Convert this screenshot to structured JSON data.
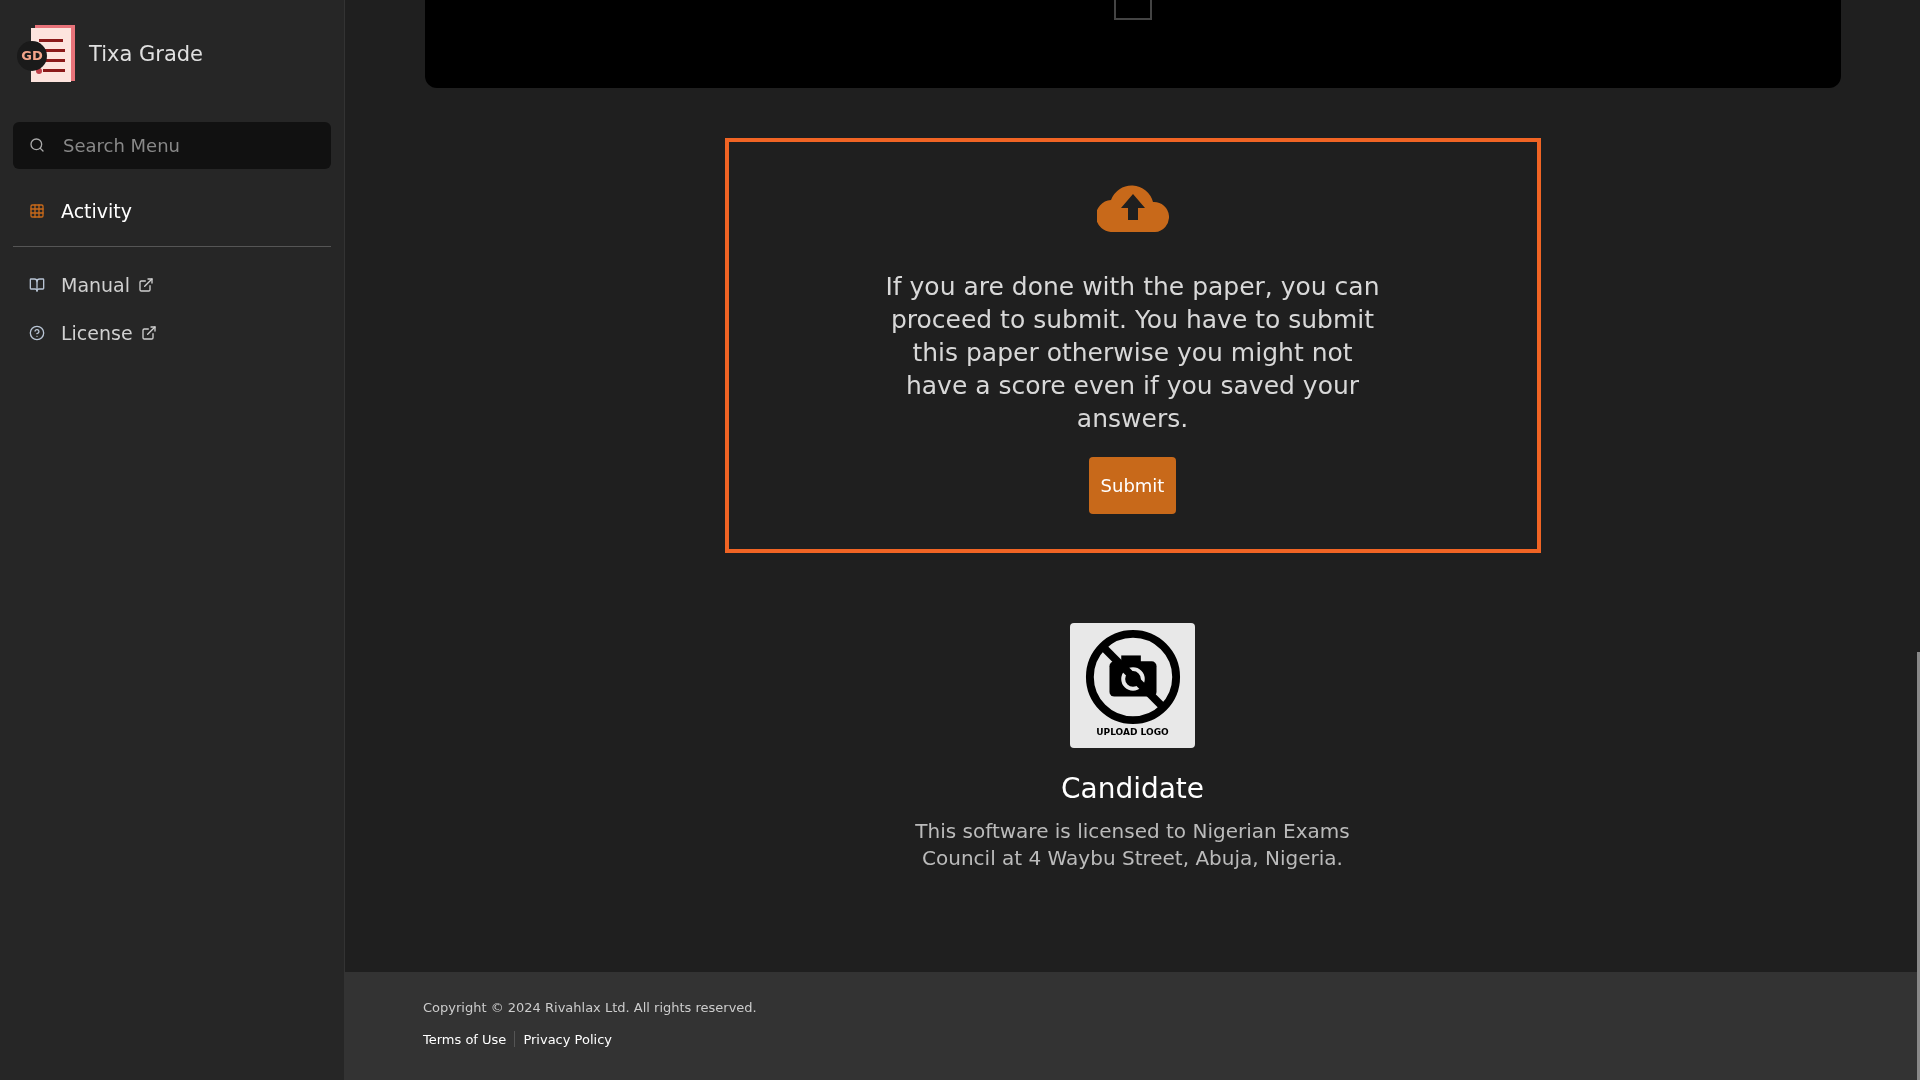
{
  "sidebar": {
    "brand": {
      "badge": "GD",
      "name": "Tixa Grade"
    },
    "search": {
      "placeholder": "Search Menu"
    },
    "items": [
      {
        "label": "Activity",
        "kind": "grid",
        "selected": true,
        "external": false
      }
    ],
    "links": [
      {
        "label": "Manual",
        "kind": "book",
        "selected": false,
        "external": true
      },
      {
        "label": "License",
        "kind": "question",
        "selected": false,
        "external": true
      }
    ]
  },
  "submit_panel": {
    "message": "If you are done with the paper, you can proceed to submit. You have to submit this paper otherwise you might not have a score even if you saved your answers.",
    "button": "Submit"
  },
  "profile": {
    "logo_caption": "UPLOAD LOGO",
    "name": "Candidate",
    "license": "This software is licensed to Nigerian Exams Council at 4 Waybu Street, Abuja, Nigeria."
  },
  "footer": {
    "copyright": "Copyright © 2024 Rivahlax Ltd. All rights reserved.",
    "links": [
      "Terms of Use",
      "Privacy Policy"
    ]
  }
}
